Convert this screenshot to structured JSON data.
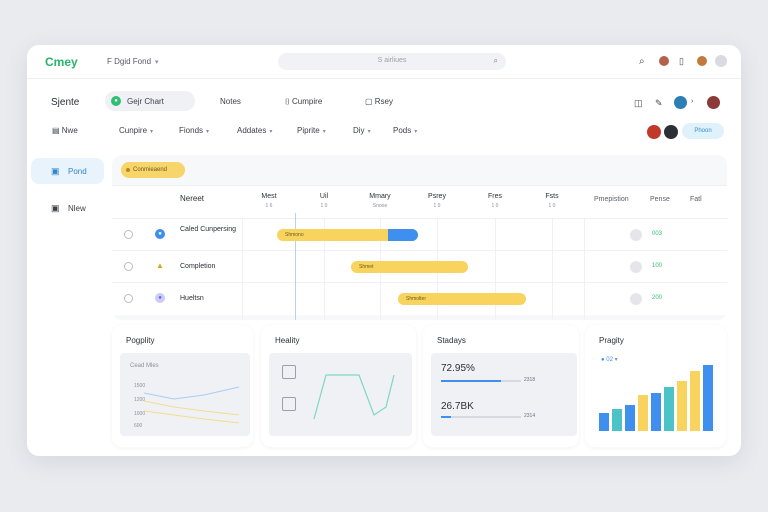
{
  "app": {
    "name": "Cmey",
    "workspace": "F Dgid Fond"
  },
  "search": {
    "placeholder": "S airliues"
  },
  "header": {
    "project": "Sjente",
    "tabs": [
      {
        "label": "Gejr Chart",
        "active": true
      },
      {
        "label": "Notes",
        "active": false
      },
      {
        "label": "Cumpire",
        "active": false
      },
      {
        "label": "Rsey",
        "active": false
      }
    ]
  },
  "toolbar": {
    "new_label": "Nwe",
    "filters": [
      "Cunpire",
      "Fionds",
      "Addates",
      "Piprite",
      "Diy",
      "Pods"
    ],
    "action_label": "Phoon"
  },
  "sidebar": {
    "items": [
      {
        "label": "Pond",
        "active": true
      },
      {
        "label": "Nlew",
        "active": false
      }
    ]
  },
  "gantt": {
    "tag": "Conmieaend",
    "name_header": "Nereet",
    "columns": [
      {
        "label": "Mest",
        "sub": "1 6"
      },
      {
        "label": "Uil",
        "sub": "1 0"
      },
      {
        "label": "Mmary",
        "sub": "Snooe"
      },
      {
        "label": "Psrey",
        "sub": "1 0"
      },
      {
        "label": "Fres",
        "sub": "1 0"
      },
      {
        "label": "Fsts",
        "sub": "1 0"
      }
    ],
    "right_headers": [
      "Pmepistion",
      "Pense",
      "Fatl"
    ],
    "rows": [
      {
        "name": "Caled Cunpersing",
        "bar_label": "Shmono",
        "progress": 0.22,
        "value": "003",
        "icon": "check"
      },
      {
        "name": "Completion",
        "bar_label": "Shmet",
        "progress": 0,
        "value": "100",
        "icon": "warning"
      },
      {
        "name": "Hueltsn",
        "bar_label": "Shmolter",
        "progress": 0,
        "value": "200",
        "icon": "user"
      }
    ]
  },
  "cards": {
    "popularity": {
      "title": "Pogplity",
      "label": "Cead Mles",
      "ticks": [
        "1500",
        "1200",
        "1000",
        "600"
      ]
    },
    "heality": {
      "title": "Heality"
    },
    "stadays": {
      "title": "Stadays",
      "stats": [
        {
          "value": "72.95%",
          "side": "2318",
          "progress": 0.75
        },
        {
          "value": "26.7BK",
          "side": "2314",
          "progress": 0.12
        }
      ]
    },
    "pragity": {
      "title": "Pragity",
      "legend": "02",
      "bars": [
        {
          "value": 18,
          "color": "#3f8fee"
        },
        {
          "value": 22,
          "color": "#4cc3c6"
        },
        {
          "value": 26,
          "color": "#3f8fee"
        },
        {
          "value": 36,
          "color": "#f8d35e"
        },
        {
          "value": 38,
          "color": "#3f8fee"
        },
        {
          "value": 44,
          "color": "#4cc3c6"
        },
        {
          "value": 50,
          "color": "#f8d35e"
        },
        {
          "value": 60,
          "color": "#f8d35e"
        },
        {
          "value": 66,
          "color": "#3f8fee"
        }
      ]
    }
  },
  "colors": {
    "accent": "#3f8fee",
    "brand": "#27b36b",
    "bar": "#f8d35e"
  }
}
